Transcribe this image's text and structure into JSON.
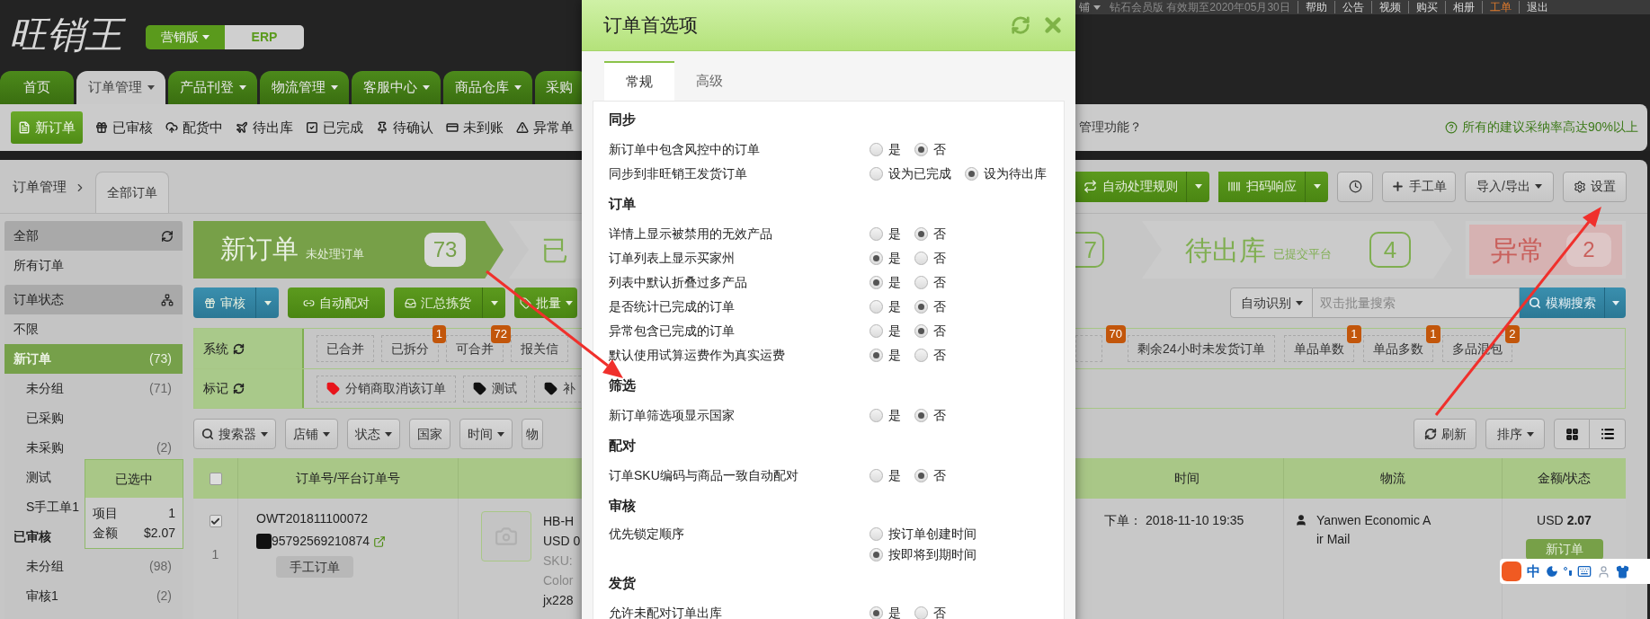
{
  "top_bar": {
    "store": "铺",
    "membership": "钻石会员版 有效期至2020年05月30日",
    "links": [
      {
        "label": "帮助",
        "highlighted": false
      },
      {
        "label": "公告",
        "highlighted": false
      },
      {
        "label": "视频",
        "highlighted": false
      },
      {
        "label": "购买",
        "highlighted": false
      },
      {
        "label": "相册",
        "highlighted": false
      },
      {
        "label": "工单",
        "highlighted": true
      },
      {
        "label": "退出",
        "highlighted": false
      }
    ]
  },
  "logo": {
    "text": "旺销王"
  },
  "edition_switch": [
    {
      "label": "营销版",
      "selected": true,
      "dropdown": true
    },
    {
      "label": "ERP",
      "selected": false,
      "dropdown": false
    }
  ],
  "nav_tabs": [
    {
      "label": "首页",
      "selected": false,
      "dropdown": false
    },
    {
      "label": "订单管理",
      "selected": true,
      "dropdown": true
    },
    {
      "label": "产品刊登",
      "selected": false,
      "dropdown": true
    },
    {
      "label": "物流管理",
      "selected": false,
      "dropdown": true
    },
    {
      "label": "客服中心",
      "selected": false,
      "dropdown": true
    },
    {
      "label": "商品仓库",
      "selected": false,
      "dropdown": true
    },
    {
      "label": "采购",
      "selected": false,
      "dropdown": false
    }
  ],
  "status_nav": [
    {
      "label": "新订单",
      "selected": true
    },
    {
      "label": "已审核",
      "selected": false
    },
    {
      "label": "配货中",
      "selected": false
    },
    {
      "label": "待出库",
      "selected": false
    },
    {
      "label": "已完成",
      "selected": false
    },
    {
      "label": "待确认",
      "selected": false
    },
    {
      "label": "未到账",
      "selected": false
    },
    {
      "label": "异常单",
      "selected": false
    }
  ],
  "notice": {
    "left": "管理功能？",
    "right": "所有的建议采纳率高达90%以上"
  },
  "breadcrumb": {
    "root": "订单管理",
    "tab": "全部订单"
  },
  "toolbar": [
    {
      "label": "自动处理规则",
      "kind": "split"
    },
    {
      "label": "扫码响应",
      "kind": "split"
    },
    {
      "kind": "icon"
    },
    {
      "label": "手工单",
      "kind": "plain"
    },
    {
      "label": "导入/导出",
      "kind": "dropdown"
    },
    {
      "label": "设置",
      "kind": "plain"
    }
  ],
  "sidebar": {
    "groups": [
      {
        "title": "全部",
        "items": [
          {
            "label": "所有订单",
            "selected": false
          }
        ]
      },
      {
        "title": "订单状态",
        "items": [
          {
            "label": "不限",
            "selected": false
          },
          {
            "label": "新订单",
            "count": "(73)",
            "selected": true,
            "children": [
              {
                "label": "未分组",
                "count": "(71)",
                "selected": false
              },
              {
                "label": "已采购",
                "selected": false
              },
              {
                "label": "未采购",
                "count": "(2)",
                "selected": false
              },
              {
                "label": "测试",
                "selected": false
              },
              {
                "label": "S手工单1",
                "selected": false
              }
            ]
          },
          {
            "label": "已审核",
            "selected": false,
            "children": [
              {
                "label": "未分组",
                "count": "(98)",
                "selected": false
              },
              {
                "label": "审核1",
                "count": "(2)",
                "selected": false
              }
            ]
          }
        ]
      }
    ]
  },
  "selection_popup": {
    "title": "已选中",
    "rows": [
      {
        "label": "项目",
        "value": "1"
      },
      {
        "label": "金额",
        "value": "$2.07"
      }
    ]
  },
  "pipeline": [
    {
      "title": "新订单",
      "subtitle": "未处理订单",
      "count": "73",
      "kind": "active"
    },
    {
      "title": "已",
      "count": "7",
      "kind": "normal"
    },
    {
      "title": "待出库",
      "subtitle": "已提交平台",
      "count": "4",
      "kind": "normal"
    },
    {
      "title": "异常",
      "count": "2",
      "kind": "alert"
    }
  ],
  "actions": [
    {
      "label": "审核",
      "kind": "split-blue"
    },
    {
      "label": "自动配对",
      "kind": "green"
    },
    {
      "label": "汇总拣货",
      "kind": "split-green"
    },
    {
      "label": "批量",
      "kind": "dropdown-green"
    }
  ],
  "search": {
    "mode": "自动识别",
    "placeholder": "双击批量搜索",
    "button": "模糊搜索"
  },
  "filter_groups": [
    {
      "label": "系统",
      "chips": [
        {
          "label": "已合并"
        },
        {
          "label": "已拆分",
          "badge": "1"
        },
        {
          "label": "可合并",
          "badge": "72"
        },
        {
          "label": "报关信"
        },
        {
          "badge": "70"
        },
        {
          "label": "剩余24小时未发货订单"
        },
        {
          "label": "单品单数",
          "badge": "1"
        },
        {
          "label": "单品多数",
          "badge": "1"
        },
        {
          "label": "多品混包",
          "badge": "2"
        }
      ]
    },
    {
      "label": "标记",
      "chips": [
        {
          "label": "分销商取消该订单",
          "color": "#e8141b"
        },
        {
          "label": "测试",
          "color": "#111111"
        },
        {
          "label": "补",
          "color": "#111111"
        }
      ]
    }
  ],
  "filters": [
    {
      "label": "搜索器",
      "dropdown": true
    },
    {
      "label": "店铺",
      "dropdown": true
    },
    {
      "label": "状态",
      "dropdown": true
    },
    {
      "label": "国家",
      "dropdown": false
    },
    {
      "label": "时间",
      "dropdown": true
    },
    {
      "label": "物"
    }
  ],
  "view_controls": {
    "refresh": "刷新",
    "sort": "排序"
  },
  "table": {
    "header_checked": false,
    "columns": [
      "订单号/平台订单号",
      "时间",
      "物流",
      "金额/状态"
    ],
    "rows": [
      {
        "checked": true,
        "index": "1",
        "order_no": "OWT201811100072",
        "platform_no": "95792569210874",
        "tag": "手工订单",
        "product": [
          "HB-H",
          "USD 0",
          "SKU:",
          "Color",
          "jx228"
        ],
        "time": "下单： 2018-11-10 19:35",
        "logistics": [
          "Yanwen Economic A",
          "ir Mail"
        ],
        "currency": "USD",
        "amount": "2.07",
        "status": "新订单"
      }
    ]
  },
  "ime_toolbar": {
    "mode": "中"
  },
  "preferences_dialog": {
    "title": "订单首选项",
    "tabs": [
      {
        "label": "常规",
        "selected": true
      },
      {
        "label": "高级",
        "selected": false
      }
    ],
    "sections": [
      {
        "heading": "同步",
        "rows": [
          {
            "label": "新订单中包含风控中的订单",
            "kind": "inline",
            "options": [
              {
                "label": "是",
                "selected": false
              },
              {
                "label": "否",
                "selected": true
              }
            ]
          },
          {
            "label": "同步到非旺销王发货订单",
            "kind": "inline",
            "options": [
              {
                "label": "设为已完成",
                "selected": false
              },
              {
                "label": "设为待出库",
                "selected": true
              }
            ]
          }
        ]
      },
      {
        "heading": "订单",
        "rows": [
          {
            "label": "详情上显示被禁用的无效产品",
            "kind": "inline",
            "options": [
              {
                "label": "是",
                "selected": false
              },
              {
                "label": "否",
                "selected": true
              }
            ]
          },
          {
            "label": "订单列表上显示买家州",
            "kind": "inline",
            "options": [
              {
                "label": "是",
                "selected": true
              },
              {
                "label": "否",
                "selected": false
              }
            ]
          },
          {
            "label": "列表中默认折叠过多产品",
            "kind": "inline",
            "options": [
              {
                "label": "是",
                "selected": true
              },
              {
                "label": "否",
                "selected": false
              }
            ]
          },
          {
            "label": "是否统计已完成的订单",
            "kind": "inline",
            "options": [
              {
                "label": "是",
                "selected": false
              },
              {
                "label": "否",
                "selected": true
              }
            ]
          },
          {
            "label": "异常包含已完成的订单",
            "kind": "inline",
            "options": [
              {
                "label": "是",
                "selected": false
              },
              {
                "label": "否",
                "selected": true
              }
            ]
          },
          {
            "label": "默认使用试算运费作为真实运费",
            "kind": "inline",
            "options": [
              {
                "label": "是",
                "selected": true
              },
              {
                "label": "否",
                "selected": false
              }
            ]
          }
        ]
      },
      {
        "heading": "筛选",
        "rows": [
          {
            "label": "新订单筛选项显示国家",
            "kind": "inline",
            "options": [
              {
                "label": "是",
                "selected": false
              },
              {
                "label": "否",
                "selected": true
              }
            ]
          }
        ]
      },
      {
        "heading": "配对",
        "rows": [
          {
            "label": "订单SKU编码与商品一致自动配对",
            "kind": "inline",
            "options": [
              {
                "label": "是",
                "selected": false
              },
              {
                "label": "否",
                "selected": true
              }
            ]
          }
        ]
      },
      {
        "heading": "审核",
        "rows": [
          {
            "label": "优先锁定顺序",
            "kind": "stacked",
            "options": [
              {
                "label": "按订单创建时间",
                "selected": false
              },
              {
                "label": "按即将到期时间",
                "selected": true
              }
            ]
          }
        ]
      },
      {
        "heading": "发货",
        "rows": [
          {
            "label": "允许未配对订单出库",
            "kind": "inline",
            "options": [
              {
                "label": "是",
                "selected": true
              },
              {
                "label": "否",
                "selected": false
              }
            ]
          }
        ]
      }
    ]
  }
}
